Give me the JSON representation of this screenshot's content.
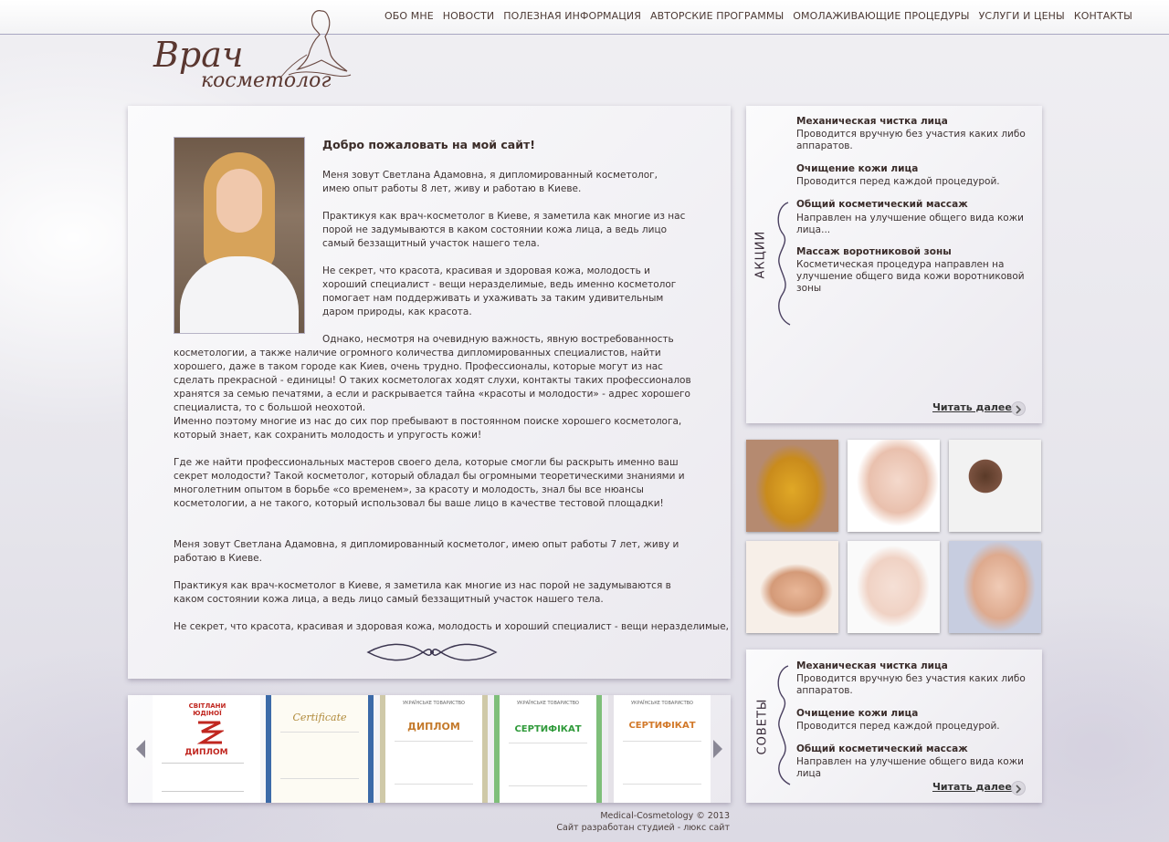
{
  "nav": {
    "items": [
      "ОБО МНЕ",
      "НОВОСТИ",
      "ПОЛЕЗНАЯ ИНФОРМАЦИЯ",
      "АВТОРСКИЕ ПРОГРАММЫ",
      "ОМОЛАЖИВАЮЩИЕ ПРОЦЕДУРЫ",
      "УСЛУГИ И ЦЕНЫ",
      "КОНТАКТЫ"
    ]
  },
  "logo": {
    "line1": "Врач",
    "line2": "косметолог"
  },
  "main": {
    "heading": "Добро пожаловать на мой сайт!",
    "p1": "Меня зовут Светлана Адамовна, я дипломированный косметолог, имею опыт работы 8 лет, живу и работаю в Киеве.",
    "p2": "Практикуя как врач-косметолог в Киеве, я заметила как многие из нас порой не задумываются в каком состоянии кожа лица, а ведь лицо самый беззащитный участок нашего тела.",
    "p3": "Не секрет,  что красота, красивая и здоровая кожа, молодость и хороший специалист - вещи неразделимые, ведь именно косметолог помогает нам поддерживать и ухаживать за таким удивительным даром природы, как красота.",
    "p4": "Однако, несмотря на очевидную важность, явную востребованность косметологии, а также наличие огромного количества дипломированных специалистов, найти хорошего, даже в таком городе как Киев, очень трудно. Профессионалы, которые могут из нас сделать прекрасной - единицы! О таких косметологах ходят слухи, контакты таких профессионалов хранятся за семью печатями, а если и раскрывается тайна «красоты и молодости» - адрес хорошего специалиста, то с большой неохотой.",
    "p5": "Именно поэтому многие из нас до сих пор пребывают в постоянном поиске хорошего косметолога, который знает, как сохранить молодость и упругость кожи!",
    "p6": "Где же найти профессиональных мастеров своего дела, которые смогли бы раскрыть именно ваш секрет молодости? Такой косметолог, который обладал бы огромными теоретическими знаниями и многолетним опытом в борьбе «со временем», за красоту и молодость, знал бы все нюансы косметологии, а не такого, который использовал бы ваше лицо в качестве тестовой площадки!",
    "p7": "Меня зовут Светлана Адамовна, я дипломированный косметолог, имею опыт работы 7 лет, живу и работаю в Киеве.",
    "p8": "Практикуя как врач-косметолог в Киеве, я заметила как многие из нас порой не задумываются в каком состоянии кожа лица, а ведь лицо самый беззащитный участок нашего тела.",
    "p9": "Не секрет,  что красота, красивая и здоровая кожа, молодость и хороший специалист - вещи неразделимые,"
  },
  "promo": {
    "label": "АКЦИИ",
    "items": [
      {
        "title": "Механическая чистка лица",
        "desc1": "Проводится вручную без участия каких либо",
        "desc2": "аппаратов."
      },
      {
        "title": "Очищение кожи лица",
        "desc1": "Проводится перед каждой процедурой.",
        "desc2": ""
      },
      {
        "title": "Общий косметический массаж",
        "desc1": "Направлен на улучшение общего вида кожи",
        "desc2": "лица..."
      },
      {
        "title": "Массаж воротниковой зоны",
        "desc1": "Косметическая процедура направлен на",
        "desc2": "улучшение общего вида кожи воротниковой зоны"
      }
    ],
    "more": "Читать далее"
  },
  "tips": {
    "label": "СОВЕТЫ",
    "items": [
      {
        "title": "Механическая чистка лица",
        "desc1": "Проводится вручную без участия каких либо",
        "desc2": "аппаратов."
      },
      {
        "title": "Очищение кожи лица",
        "desc1": "Проводится перед каждой процедурой.",
        "desc2": ""
      },
      {
        "title": "Общий косметический массаж",
        "desc1": "Направлен на улучшение общего вида кожи лица",
        "desc2": ""
      }
    ],
    "more": "Читать далее"
  },
  "certs": [
    {
      "title": "ДИПЛОМ",
      "header": "СВІТЛАНИ ЮДІНОЇ",
      "color": "#c0261f"
    },
    {
      "title": "Certificate",
      "header": "",
      "color": "#b08a3a"
    },
    {
      "title": "ДИПЛОМ",
      "header": "УКРАЇНСЬКЕ ТОВАРИСТВО",
      "color": "#c47a2c"
    },
    {
      "title": "СЕРТИФІКАТ",
      "header": "УКРАЇНСЬКЕ ТОВАРИСТВО",
      "color": "#2f9a3a"
    },
    {
      "title": "СЕРТИФІКАТ",
      "header": "УКРАЇНСЬКЕ ТОВАРИСТВО",
      "color": "#d2792a"
    }
  ],
  "footer": {
    "copy": "Medical-Cosmetology © 2013",
    "studio": "Сайт разработан студией - люкс сайт"
  },
  "colors": {
    "accent": "#4d3b36",
    "border": "#a9a6c2"
  }
}
